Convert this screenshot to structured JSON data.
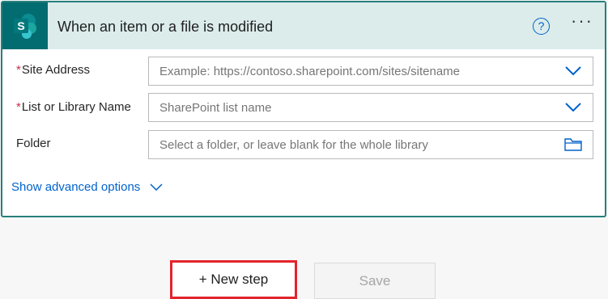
{
  "trigger": {
    "connector_icon": "sharepoint-icon",
    "connector_color": "#036c70",
    "title": "When an item or a file is modified",
    "help_glyph": "?",
    "more_glyph": "···"
  },
  "fields": [
    {
      "label": "Site Address",
      "required": "*",
      "placeholder": "Example: https://contoso.sharepoint.com/sites/sitename",
      "trail_icon": "chevron-down-icon"
    },
    {
      "label": "List or Library Name",
      "required": "*",
      "placeholder": "SharePoint list name",
      "trail_icon": "chevron-down-icon"
    },
    {
      "label": "Folder",
      "placeholder": "Select a folder, or leave blank for the whole library",
      "trail_icon": "folder-icon"
    }
  ],
  "advanced": {
    "label": "Show advanced options"
  },
  "actions": {
    "new_step_label": "+ New step",
    "save_label": "Save"
  },
  "colors": {
    "accent": "#277f7b",
    "header_bg": "#dbeceb",
    "link": "#0062cc",
    "highlight": "#e3242b"
  }
}
